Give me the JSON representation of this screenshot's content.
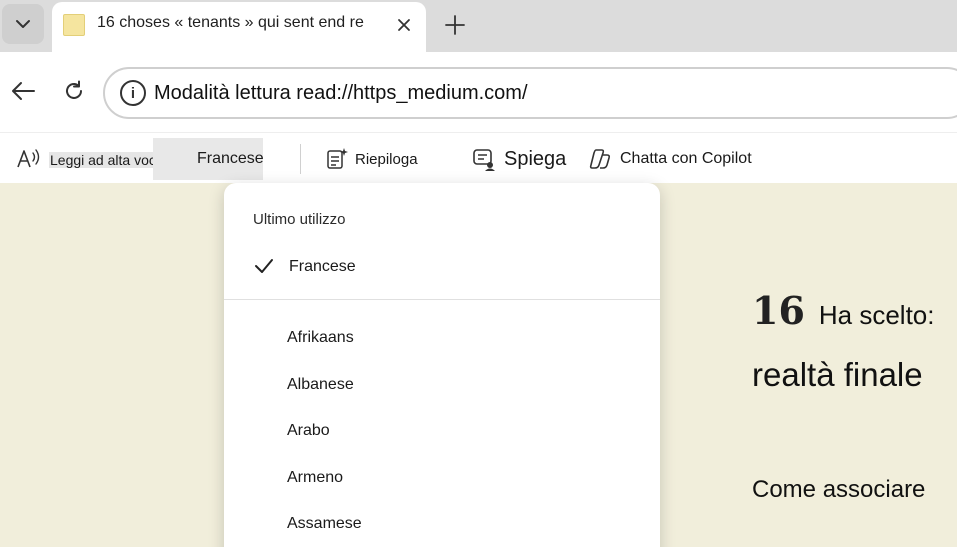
{
  "browser": {
    "tab": {
      "title": "16 choses « tenants » qui sent end re"
    },
    "address_bar": {
      "url": "Modalità lettura read://https_medium.com/"
    }
  },
  "reader_toolbar": {
    "read_aloud_label": "Leggi ad alta voce ab",
    "language": "Francese",
    "summarize_label": "Riepiloga",
    "explain_label": "Spiega",
    "copilot_label": "Chatta con Copilot"
  },
  "language_dropdown": {
    "section_label": "Ultimo utilizzo",
    "selected": "Francese",
    "languages": [
      "Afrikaans",
      "Albanese",
      "Arabo",
      "Armeno",
      "Assamese"
    ]
  },
  "article": {
    "number": "16",
    "line1": "Ha scelto:",
    "line2": "realtà finale",
    "line3": "Come associare"
  },
  "colors": {
    "article_bg": "#f1eedb",
    "tabstrip_bg": "#dcdcdc",
    "toolbar_highlight": "#e8e8e8"
  }
}
